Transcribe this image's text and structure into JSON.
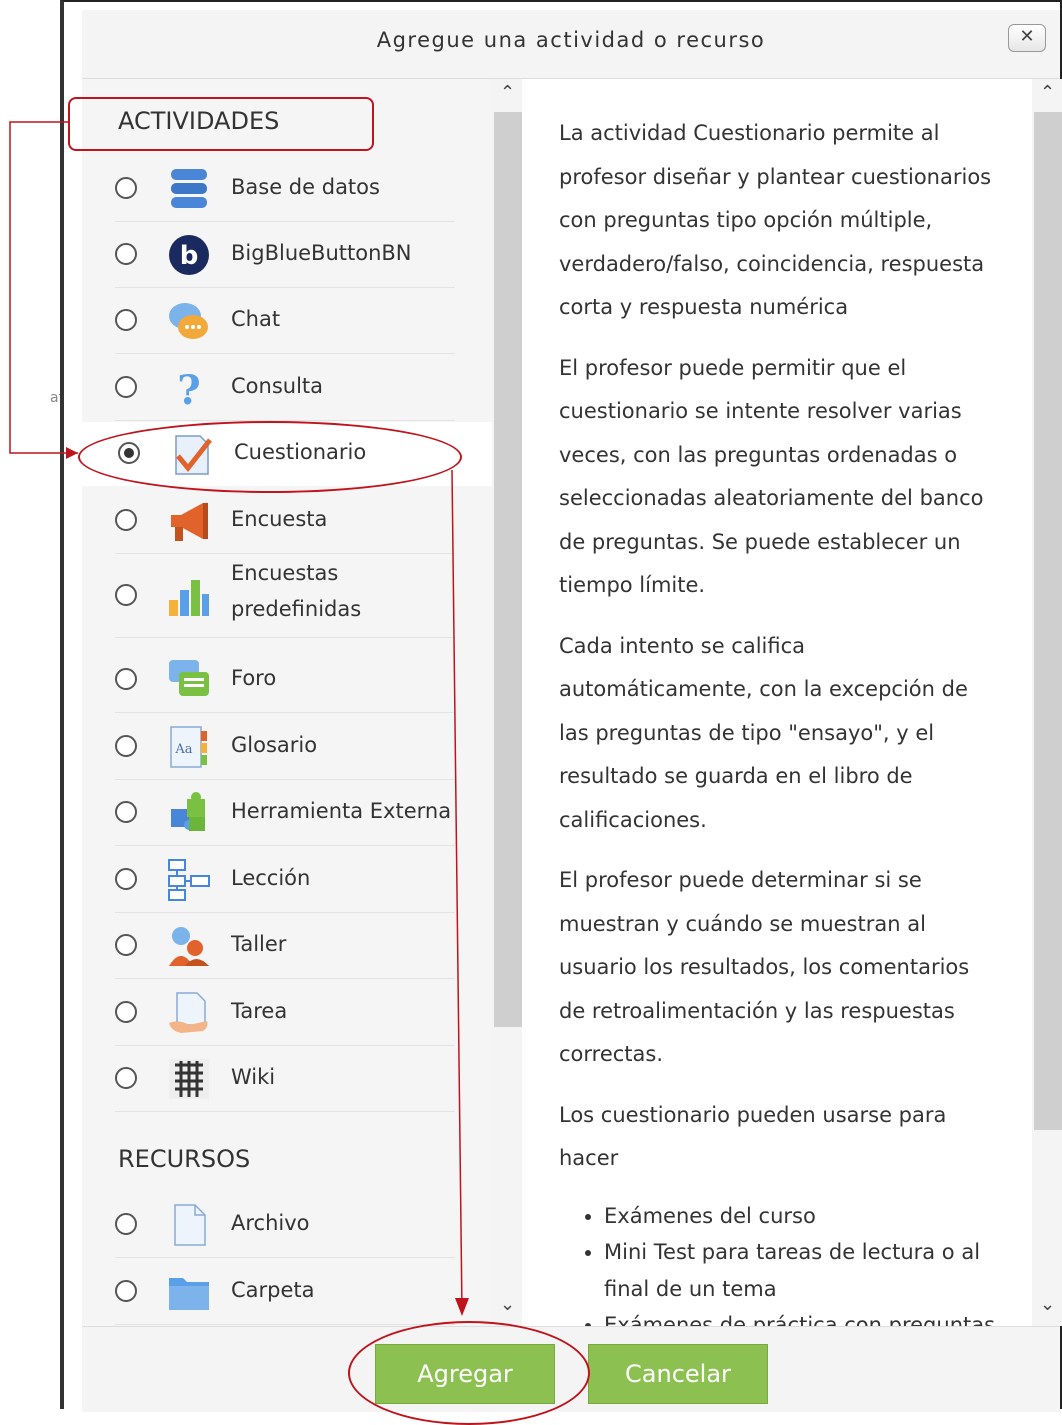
{
  "dialog": {
    "title": "Agregue una actividad o recurso",
    "close_label": "✕"
  },
  "sections": {
    "activities": "ACTIVIDADES",
    "resources": "RECURSOS"
  },
  "activities": [
    {
      "label": "Base de datos",
      "icon": "database-icon",
      "selected": false
    },
    {
      "label": "BigBlueButtonBN",
      "icon": "bigbluebutton-icon",
      "selected": false
    },
    {
      "label": "Chat",
      "icon": "chat-icon",
      "selected": false
    },
    {
      "label": "Consulta",
      "icon": "question-icon",
      "selected": false
    },
    {
      "label": "Cuestionario",
      "icon": "quiz-icon",
      "selected": true
    },
    {
      "label": "Encuesta",
      "icon": "megaphone-icon",
      "selected": false
    },
    {
      "label": "Encuestas predefinidas",
      "icon": "bar-chart-icon",
      "selected": false
    },
    {
      "label": "Foro",
      "icon": "forum-icon",
      "selected": false
    },
    {
      "label": "Glosario",
      "icon": "glossary-icon",
      "selected": false
    },
    {
      "label": "Herramienta Externa",
      "icon": "puzzle-icon",
      "selected": false
    },
    {
      "label": "Lección",
      "icon": "lesson-icon",
      "selected": false
    },
    {
      "label": "Taller",
      "icon": "workshop-icon",
      "selected": false
    },
    {
      "label": "Tarea",
      "icon": "assignment-icon",
      "selected": false
    },
    {
      "label": "Wiki",
      "icon": "wiki-icon",
      "selected": false
    }
  ],
  "resources": [
    {
      "label": "Archivo",
      "icon": "file-icon",
      "selected": false
    },
    {
      "label": "Carpeta",
      "icon": "folder-icon",
      "selected": false
    }
  ],
  "description": {
    "p1": "La actividad Cuestionario permite al profesor diseñar y plantear cuestionarios con preguntas tipo opción múltiple, verdadero/falso, coincidencia, respuesta corta y respuesta numérica",
    "p2": "El profesor puede permitir que el cuestionario se intente resolver varias veces, con las preguntas ordenadas o seleccionadas aleatoriamente del banco de preguntas. Se puede establecer un tiempo límite.",
    "p3": "Cada intento se califica automáticamente, con la excepción de las preguntas de tipo \"ensayo\", y el resultado se guarda en el libro de calificaciones.",
    "p4": "El profesor puede determinar si se muestran y cuándo se muestran al usuario los resultados, los comentarios de retroalimentación y las respuestas correctas.",
    "p5": "Los cuestionario pueden usarse para hacer",
    "bullets": [
      "Exámenes del curso",
      "Mini Test para tareas de lectura o al final de un tema",
      "Exámenes de práctica con preguntas de exámenes anteriores"
    ]
  },
  "buttons": {
    "add": "Agregar",
    "cancel": "Cancelar"
  },
  "background_fragment": "af",
  "colors": {
    "accent_green": "#8cc152",
    "annotation_red": "#c0141c",
    "header_bg": "#f4f4f4",
    "list_bg": "#f5f5f5"
  }
}
